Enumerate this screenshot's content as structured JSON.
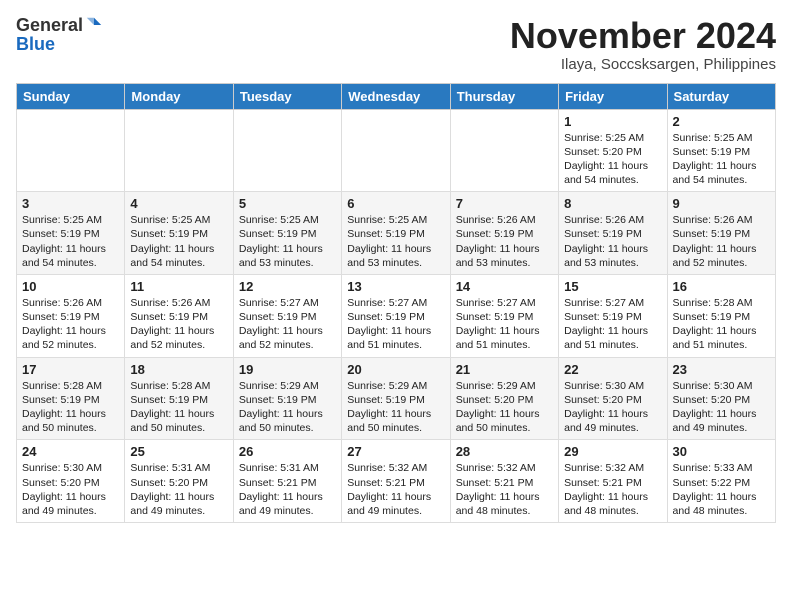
{
  "header": {
    "logo_general": "General",
    "logo_blue": "Blue",
    "month_title": "November 2024",
    "location": "Ilaya, Soccsksargen, Philippines"
  },
  "days_of_week": [
    "Sunday",
    "Monday",
    "Tuesday",
    "Wednesday",
    "Thursday",
    "Friday",
    "Saturday"
  ],
  "weeks": [
    [
      {
        "day": "",
        "info": ""
      },
      {
        "day": "",
        "info": ""
      },
      {
        "day": "",
        "info": ""
      },
      {
        "day": "",
        "info": ""
      },
      {
        "day": "",
        "info": ""
      },
      {
        "day": "1",
        "info": "Sunrise: 5:25 AM\nSunset: 5:20 PM\nDaylight: 11 hours\nand 54 minutes."
      },
      {
        "day": "2",
        "info": "Sunrise: 5:25 AM\nSunset: 5:19 PM\nDaylight: 11 hours\nand 54 minutes."
      }
    ],
    [
      {
        "day": "3",
        "info": "Sunrise: 5:25 AM\nSunset: 5:19 PM\nDaylight: 11 hours\nand 54 minutes."
      },
      {
        "day": "4",
        "info": "Sunrise: 5:25 AM\nSunset: 5:19 PM\nDaylight: 11 hours\nand 54 minutes."
      },
      {
        "day": "5",
        "info": "Sunrise: 5:25 AM\nSunset: 5:19 PM\nDaylight: 11 hours\nand 53 minutes."
      },
      {
        "day": "6",
        "info": "Sunrise: 5:25 AM\nSunset: 5:19 PM\nDaylight: 11 hours\nand 53 minutes."
      },
      {
        "day": "7",
        "info": "Sunrise: 5:26 AM\nSunset: 5:19 PM\nDaylight: 11 hours\nand 53 minutes."
      },
      {
        "day": "8",
        "info": "Sunrise: 5:26 AM\nSunset: 5:19 PM\nDaylight: 11 hours\nand 53 minutes."
      },
      {
        "day": "9",
        "info": "Sunrise: 5:26 AM\nSunset: 5:19 PM\nDaylight: 11 hours\nand 52 minutes."
      }
    ],
    [
      {
        "day": "10",
        "info": "Sunrise: 5:26 AM\nSunset: 5:19 PM\nDaylight: 11 hours\nand 52 minutes."
      },
      {
        "day": "11",
        "info": "Sunrise: 5:26 AM\nSunset: 5:19 PM\nDaylight: 11 hours\nand 52 minutes."
      },
      {
        "day": "12",
        "info": "Sunrise: 5:27 AM\nSunset: 5:19 PM\nDaylight: 11 hours\nand 52 minutes."
      },
      {
        "day": "13",
        "info": "Sunrise: 5:27 AM\nSunset: 5:19 PM\nDaylight: 11 hours\nand 51 minutes."
      },
      {
        "day": "14",
        "info": "Sunrise: 5:27 AM\nSunset: 5:19 PM\nDaylight: 11 hours\nand 51 minutes."
      },
      {
        "day": "15",
        "info": "Sunrise: 5:27 AM\nSunset: 5:19 PM\nDaylight: 11 hours\nand 51 minutes."
      },
      {
        "day": "16",
        "info": "Sunrise: 5:28 AM\nSunset: 5:19 PM\nDaylight: 11 hours\nand 51 minutes."
      }
    ],
    [
      {
        "day": "17",
        "info": "Sunrise: 5:28 AM\nSunset: 5:19 PM\nDaylight: 11 hours\nand 50 minutes."
      },
      {
        "day": "18",
        "info": "Sunrise: 5:28 AM\nSunset: 5:19 PM\nDaylight: 11 hours\nand 50 minutes."
      },
      {
        "day": "19",
        "info": "Sunrise: 5:29 AM\nSunset: 5:19 PM\nDaylight: 11 hours\nand 50 minutes."
      },
      {
        "day": "20",
        "info": "Sunrise: 5:29 AM\nSunset: 5:19 PM\nDaylight: 11 hours\nand 50 minutes."
      },
      {
        "day": "21",
        "info": "Sunrise: 5:29 AM\nSunset: 5:20 PM\nDaylight: 11 hours\nand 50 minutes."
      },
      {
        "day": "22",
        "info": "Sunrise: 5:30 AM\nSunset: 5:20 PM\nDaylight: 11 hours\nand 49 minutes."
      },
      {
        "day": "23",
        "info": "Sunrise: 5:30 AM\nSunset: 5:20 PM\nDaylight: 11 hours\nand 49 minutes."
      }
    ],
    [
      {
        "day": "24",
        "info": "Sunrise: 5:30 AM\nSunset: 5:20 PM\nDaylight: 11 hours\nand 49 minutes."
      },
      {
        "day": "25",
        "info": "Sunrise: 5:31 AM\nSunset: 5:20 PM\nDaylight: 11 hours\nand 49 minutes."
      },
      {
        "day": "26",
        "info": "Sunrise: 5:31 AM\nSunset: 5:21 PM\nDaylight: 11 hours\nand 49 minutes."
      },
      {
        "day": "27",
        "info": "Sunrise: 5:32 AM\nSunset: 5:21 PM\nDaylight: 11 hours\nand 49 minutes."
      },
      {
        "day": "28",
        "info": "Sunrise: 5:32 AM\nSunset: 5:21 PM\nDaylight: 11 hours\nand 48 minutes."
      },
      {
        "day": "29",
        "info": "Sunrise: 5:32 AM\nSunset: 5:21 PM\nDaylight: 11 hours\nand 48 minutes."
      },
      {
        "day": "30",
        "info": "Sunrise: 5:33 AM\nSunset: 5:22 PM\nDaylight: 11 hours\nand 48 minutes."
      }
    ]
  ]
}
